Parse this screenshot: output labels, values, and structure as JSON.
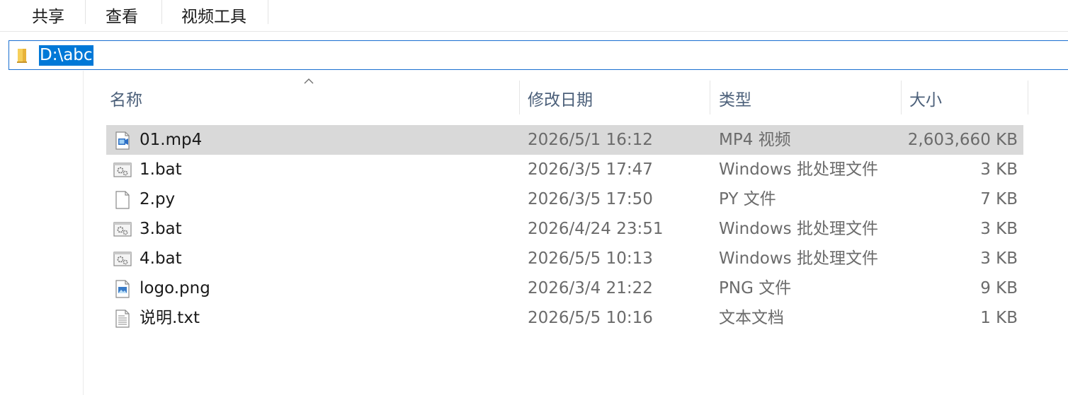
{
  "ribbon": {
    "tabs": [
      {
        "label": "共享"
      },
      {
        "label": "查看"
      },
      {
        "label": "视频工具"
      }
    ]
  },
  "address": {
    "path": "D:\\abc",
    "icon": "folder-icon"
  },
  "columns": {
    "name": "名称",
    "date": "修改日期",
    "type": "类型",
    "size": "大小"
  },
  "files": [
    {
      "name": "01.mp4",
      "date": "2026/5/1 16:12",
      "type": "MP4 视频",
      "size": "2,603,660 KB",
      "icon": "video-file-icon",
      "selected": true
    },
    {
      "name": "1.bat",
      "date": "2026/3/5 17:47",
      "type": "Windows 批处理文件",
      "size": "3 KB",
      "icon": "batch-file-icon",
      "selected": false
    },
    {
      "name": "2.py",
      "date": "2026/3/5 17:50",
      "type": "PY 文件",
      "size": "7 KB",
      "icon": "blank-file-icon",
      "selected": false
    },
    {
      "name": "3.bat",
      "date": "2026/4/24 23:51",
      "type": "Windows 批处理文件",
      "size": "3 KB",
      "icon": "batch-file-icon",
      "selected": false
    },
    {
      "name": "4.bat",
      "date": "2026/5/5 10:13",
      "type": "Windows 批处理文件",
      "size": "3 KB",
      "icon": "batch-file-icon",
      "selected": false
    },
    {
      "name": "logo.png",
      "date": "2026/3/4 21:22",
      "type": "PNG 文件",
      "size": "9 KB",
      "icon": "image-file-icon",
      "selected": false
    },
    {
      "name": "说明.txt",
      "date": "2026/5/5 10:16",
      "type": "文本文档",
      "size": "1 KB",
      "icon": "text-file-icon",
      "selected": false
    }
  ],
  "colors": {
    "selection": "#d9d9d9",
    "address_highlight": "#0078d7",
    "header_text": "#4c607a"
  }
}
